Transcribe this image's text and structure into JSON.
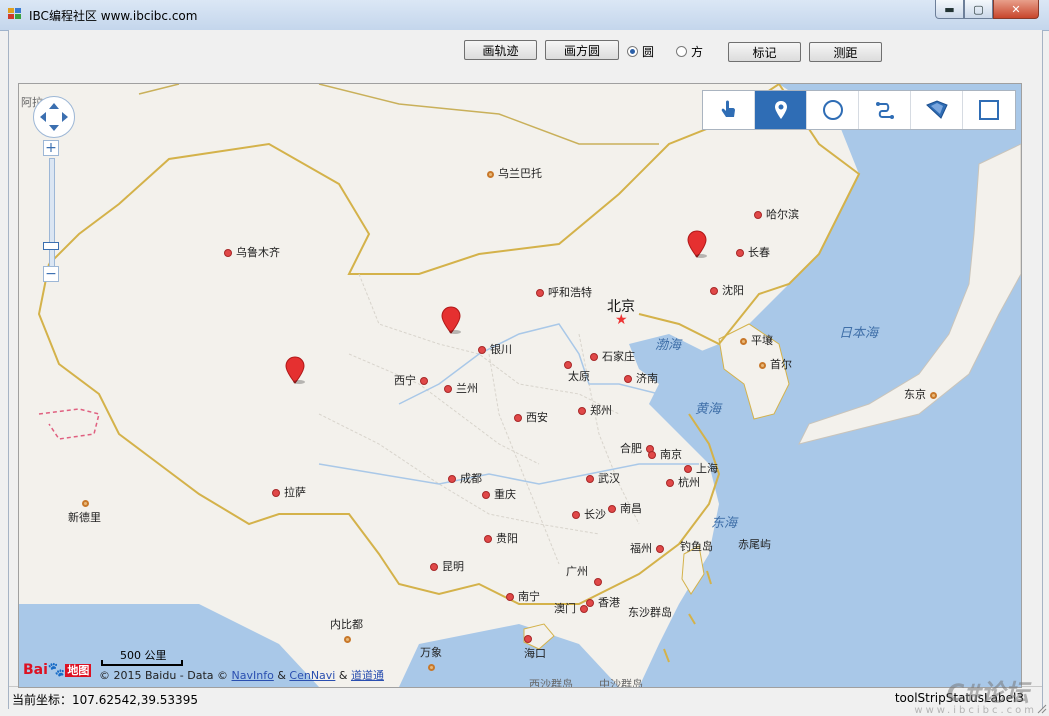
{
  "window": {
    "title": "IBC编程社区 www.ibcibc.com",
    "min_icon": "minimize-icon",
    "max_icon": "maximize-icon",
    "close_icon": "close-icon",
    "min_glyph": "▬",
    "max_glyph": "▢",
    "close_glyph": "✕"
  },
  "toolbar": {
    "draw_track": "画轨迹",
    "draw_square_circle": "画方圆",
    "radio_circle": "圆",
    "radio_square": "方",
    "radio_selected": "circle",
    "mark": "标记",
    "measure": "测距"
  },
  "map": {
    "land_color": "#f3f1ec",
    "sea_color": "#a9c8e8",
    "border_color": "#d4b24a",
    "marker_color": "#e53030",
    "cities": [
      {
        "name": "乌兰巴托",
        "cap": true
      },
      {
        "name": "哈尔滨",
        "cap": false
      },
      {
        "name": "长春",
        "cap": false
      },
      {
        "name": "乌鲁木齐",
        "cap": false
      },
      {
        "name": "沈阳",
        "cap": false
      },
      {
        "name": "呼和浩特",
        "cap": false
      },
      {
        "name": "平壤",
        "cap": true
      },
      {
        "name": "首尔",
        "cap": true
      },
      {
        "name": "银川",
        "cap": false
      },
      {
        "name": "石家庄",
        "cap": false
      },
      {
        "name": "太原",
        "cap": false
      },
      {
        "name": "济南",
        "cap": false
      },
      {
        "name": "西宁",
        "cap": false
      },
      {
        "name": "兰州",
        "cap": false
      },
      {
        "name": "西安",
        "cap": false
      },
      {
        "name": "郑州",
        "cap": false
      },
      {
        "name": "东京",
        "cap": true
      },
      {
        "name": "合肥",
        "cap": false
      },
      {
        "name": "南京",
        "cap": false
      },
      {
        "name": "上海",
        "cap": false
      },
      {
        "name": "成都",
        "cap": false
      },
      {
        "name": "武汉",
        "cap": false
      },
      {
        "name": "杭州",
        "cap": false
      },
      {
        "name": "拉萨",
        "cap": false
      },
      {
        "name": "重庆",
        "cap": false
      },
      {
        "name": "长沙",
        "cap": false
      },
      {
        "name": "南昌",
        "cap": false
      },
      {
        "name": "新德里",
        "cap": true
      },
      {
        "name": "贵阳",
        "cap": false
      },
      {
        "name": "福州",
        "cap": false
      },
      {
        "name": "昆明",
        "cap": false
      },
      {
        "name": "广州",
        "cap": false
      },
      {
        "name": "南宁",
        "cap": false
      },
      {
        "name": "香港",
        "cap": false
      },
      {
        "name": "澳门",
        "cap": false
      },
      {
        "name": "内比都",
        "cap": true
      },
      {
        "name": "海口",
        "cap": false
      },
      {
        "name": "万象",
        "cap": true
      }
    ],
    "capital_label": "北京",
    "seas": [
      "渤海",
      "黄海",
      "日本海",
      "东海"
    ],
    "islands": [
      "钓鱼岛",
      "赤尾屿",
      "东沙群岛"
    ],
    "cut_labels": [
      "阿拉",
      "西沙群岛",
      "中沙群岛"
    ],
    "scale_label": "500 公里",
    "logo_text": "Bai",
    "logo_paw": "🐾",
    "logo_ditu": "地图",
    "copyright_prefix": "© 2015 Baidu - Data ©",
    "navinfo": "NavInfo",
    "amp1": "&",
    "cennavi": "CenNavi",
    "amp2": "&",
    "daodaotong": "道道通",
    "zoom_in": "+",
    "zoom_out": "−",
    "draw_tools": [
      {
        "name": "hand-pointer-icon",
        "active": false
      },
      {
        "name": "marker-tool-icon",
        "active": true
      },
      {
        "name": "circle-tool-icon",
        "active": false
      },
      {
        "name": "polyline-tool-icon",
        "active": false
      },
      {
        "name": "polygon-tool-icon",
        "active": false
      },
      {
        "name": "rectangle-tool-icon",
        "active": false
      }
    ]
  },
  "status": {
    "coords": "当前坐标：107.62542,39.53395",
    "label": "toolStripStatusLabel3"
  },
  "watermark": {
    "text": "C#论坛",
    "url": "www.ibcibc.com"
  }
}
